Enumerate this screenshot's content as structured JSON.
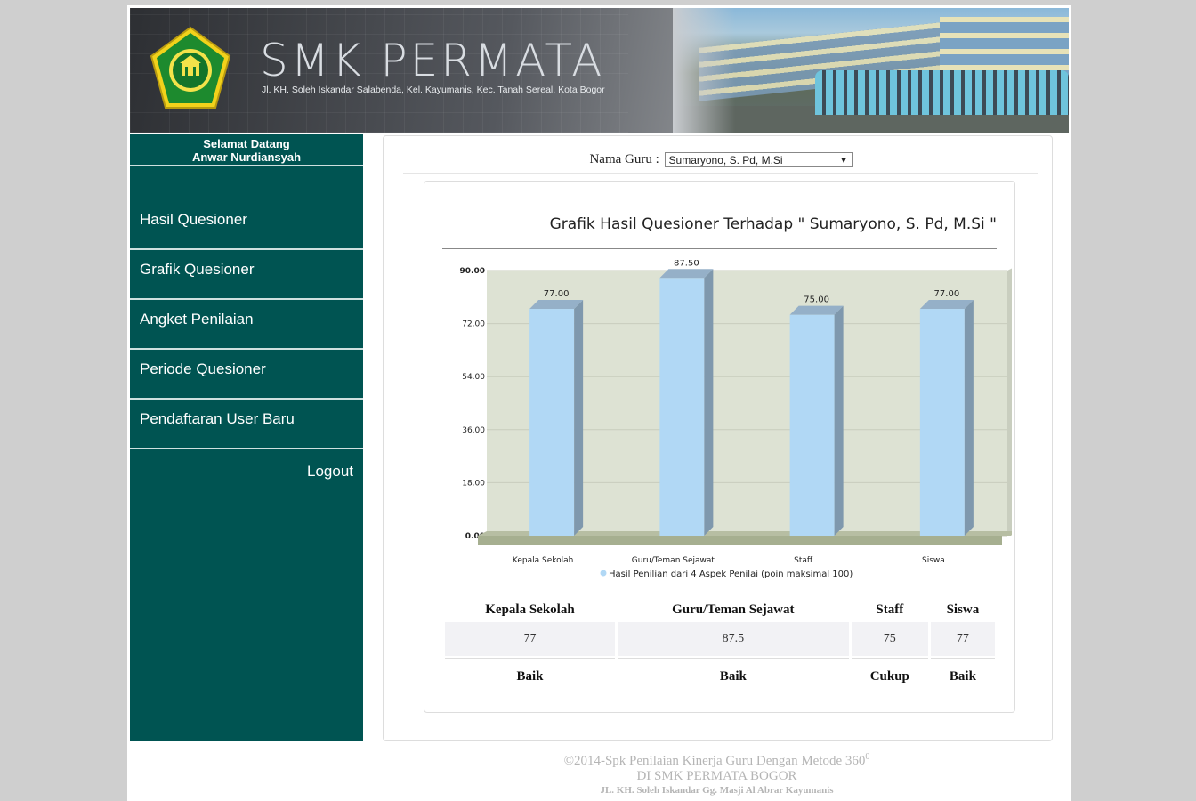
{
  "banner": {
    "school_name": "SMK PERMATA",
    "address": "Jl. KH. Soleh Iskandar Salabenda, Kel. Kayumanis, Kec. Tanah Sereal, Kota Bogor",
    "logo_icon": "school-emblem-icon"
  },
  "sidebar": {
    "welcome": "Selamat Datang",
    "user_name": "Anwar Nurdiansyah",
    "items": [
      {
        "label": "Hasil Quesioner"
      },
      {
        "label": "Grafik Quesioner"
      },
      {
        "label": "Angket Penilaian"
      },
      {
        "label": "Periode Quesioner"
      },
      {
        "label": "Pendaftaran User Baru"
      }
    ],
    "logout": "Logout"
  },
  "filter": {
    "label": "Nama Guru :",
    "selected": "Sumaryono, S. Pd, M.Si",
    "arrow": "▼"
  },
  "chart_data": {
    "type": "bar",
    "title": "Grafik Hasil Quesioner Terhadap \" Sumaryono, S. Pd, M.Si \"",
    "categories": [
      "Kepala Sekolah",
      "Guru/Teman Sejawat",
      "Staff",
      "Siswa"
    ],
    "series": [
      {
        "name": "Hasil Penilian dari 4 Aspek Penilai (poin maksimal 100)",
        "values": [
          77.0,
          87.5,
          75.0,
          77.0
        ]
      }
    ],
    "value_labels": [
      "77.00",
      "87.50",
      "75.00",
      "77.00"
    ],
    "y_ticks": [
      "90.00",
      "72.00",
      "54.00",
      "36.00",
      "18.00",
      "0.00"
    ],
    "ylim": [
      0,
      90
    ],
    "grid": true,
    "legend_position": "bottom",
    "colors": {
      "bar_front": "#b1d8f5",
      "bar_side": "#7f98ad",
      "bar_top": "#95b0c8",
      "plot_bg": "#dde2d3",
      "floor": "#a6af90"
    }
  },
  "table": {
    "headers": [
      "Kepala Sekolah",
      "Guru/Teman Sejawat",
      "Staff",
      "Siswa"
    ],
    "values": [
      "77",
      "87.5",
      "75",
      "77"
    ],
    "categories": [
      "Baik",
      "Baik",
      "Cukup",
      "Baik"
    ]
  },
  "footer": {
    "line1": "©2014-Spk Penilaian Kinerja Guru Dengan Metode 360",
    "line1_sup": "0",
    "line2": "DI SMK PERMATA BOGOR",
    "line3": "JL. KH. Soleh Iskandar Gg. Masji Al Abrar Kayumanis"
  }
}
